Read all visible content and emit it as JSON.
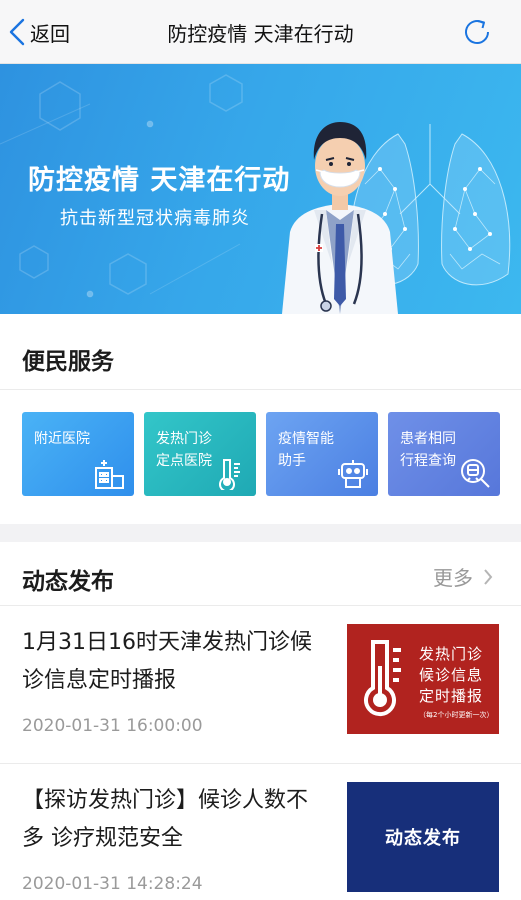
{
  "nav": {
    "back_label": "返回",
    "title": "防控疫情 天津在行动"
  },
  "banner": {
    "title": "防控疫情 天津在行动",
    "subtitle": "抗击新型冠状病毒肺炎"
  },
  "services": {
    "section_title": "便民服务",
    "cards": [
      {
        "line1": "附近医院",
        "line2": "",
        "icon": "hospital-icon",
        "color": "#3aa2f1"
      },
      {
        "line1": "发热门诊",
        "line2": "定点医院",
        "icon": "thermometer-icon",
        "color": "#29b8bf"
      },
      {
        "line1": "疫情智能",
        "line2": "助手",
        "icon": "robot-icon",
        "color": "#5c92ea"
      },
      {
        "line1": "患者相同",
        "line2": "行程查询",
        "icon": "train-search-icon",
        "color": "#6484e1"
      }
    ]
  },
  "news": {
    "section_title": "动态发布",
    "more_label": "更多",
    "items": [
      {
        "title": "1月31日16时天津发热门诊候诊信息定时播报",
        "time": "2020-01-31 16:00:00",
        "thumb_lines": [
          "发热门诊",
          "候诊信息",
          "定时播报"
        ],
        "thumb_small": "（每2个小时更新一次）",
        "thumb_color": "#b1231f"
      },
      {
        "title": "【探访发热门诊】候诊人数不多 诊疗规范安全",
        "time": "2020-01-31 14:28:24",
        "thumb_text": "动态发布",
        "thumb_color": "#172f7a"
      }
    ]
  }
}
